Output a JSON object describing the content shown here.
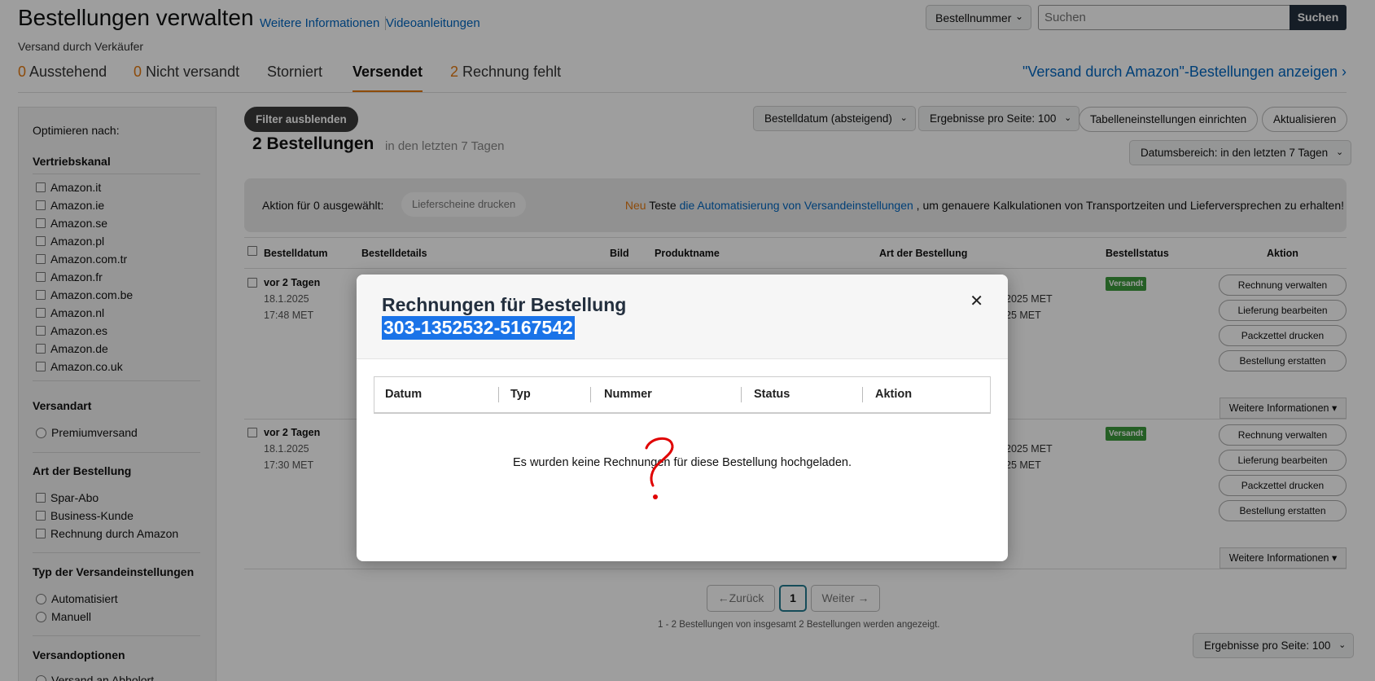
{
  "header": {
    "title": "Bestellungen verwalten",
    "link_info": "Weitere Informationen",
    "link_videos": "Videoanleitungen",
    "subtitle": "Versand durch Verkäufer",
    "search_select": "Bestellnummer",
    "search_placeholder": "Suchen",
    "search_button": "Suchen"
  },
  "tabs": [
    {
      "count": "0",
      "label": "Ausstehend"
    },
    {
      "count": "0",
      "label": "Nicht versandt"
    },
    {
      "count": "",
      "label": "Storniert"
    },
    {
      "count": "",
      "label": "Versendet"
    },
    {
      "count": "2",
      "label": "Rechnung fehlt"
    }
  ],
  "fba_link": "\"Versand durch Amazon\"-Bestellungen anzeigen",
  "sidebar": {
    "optimize": "Optimieren nach:",
    "channel_head": "Vertriebskanal",
    "channels": [
      "Amazon.it",
      "Amazon.ie",
      "Amazon.se",
      "Amazon.pl",
      "Amazon.com.tr",
      "Amazon.fr",
      "Amazon.com.be",
      "Amazon.nl",
      "Amazon.es",
      "Amazon.de",
      "Amazon.co.uk"
    ],
    "shipping_head": "Versandart",
    "shipping": [
      "Premiumversand"
    ],
    "ordertype_head": "Art der Bestellung",
    "ordertypes": [
      "Spar-Abo",
      "Business-Kunde",
      "Rechnung durch Amazon"
    ],
    "settings_head": "Typ der Versandeinstellungen",
    "settings": [
      "Automatisiert",
      "Manuell"
    ],
    "options_head": "Versandoptionen",
    "options": [
      "Versand an Abholort"
    ]
  },
  "toolbar": {
    "hide_filters": "Filter ausblenden",
    "sort": "Bestelldatum (absteigend)",
    "per_page": "Ergebnisse pro Seite: 100",
    "table_settings": "Tabelleneinstellungen einrichten",
    "refresh": "Aktualisieren",
    "date_range": "Datumsbereich: in den letzten 7 Tagen",
    "orders_count": "2 Bestellungen",
    "orders_sub": "in den letzten 7 Tagen"
  },
  "action_bar": {
    "selected": "Aktion für 0 ausgewählt:",
    "print_button": "Lieferscheine drucken",
    "neu": "Neu",
    "teste": "Teste",
    "link": "die Automatisierung von Versandeinstellungen",
    "rest": ", um genauere Kalkulationen von Transportzeiten und Lieferversprechen zu erhalten!"
  },
  "table": {
    "headers": [
      "Bestelldatum",
      "Bestelldetails",
      "Bild",
      "Produktname",
      "Art der Bestellung",
      "Bestellstatus",
      "Aktion"
    ],
    "rows": [
      {
        "ago": "vor 2 Tagen",
        "date": "18.1.2025",
        "time": "17:48 MET",
        "mid1": "2025 MET",
        "mid2": "25 MET",
        "status": "Versandt"
      },
      {
        "ago": "vor 2 Tagen",
        "date": "18.1.2025",
        "time": "17:30 MET",
        "mid1": "2025 MET",
        "mid2": "25 MET",
        "status": "Versandt"
      }
    ],
    "actions": [
      "Rechnung verwalten",
      "Lieferung bearbeiten",
      "Packzettel drucken",
      "Bestellung erstatten"
    ],
    "more": "Weitere Informationen ▾"
  },
  "pagination": {
    "prev": "←Zurück",
    "current": "1",
    "next": "Weiter →",
    "info": "1 - 2 Bestellungen von insgesamt 2 Bestellungen werden angezeigt.",
    "per_page": "Ergebnisse pro Seite: 100"
  },
  "modal": {
    "title": "Rechnungen für Bestellung",
    "order_number": "303-1352532-5167542",
    "columns": [
      "Datum",
      "Typ",
      "Nummer",
      "Status",
      "Aktion"
    ],
    "empty": "Es wurden keine Rechnungen für diese Bestellung hochgeladen."
  },
  "colors": {
    "accent": "#e47911",
    "link": "#0066c0",
    "dark": "#232f3e",
    "badge": "#3c9a3c",
    "selection": "#1a73e8"
  }
}
